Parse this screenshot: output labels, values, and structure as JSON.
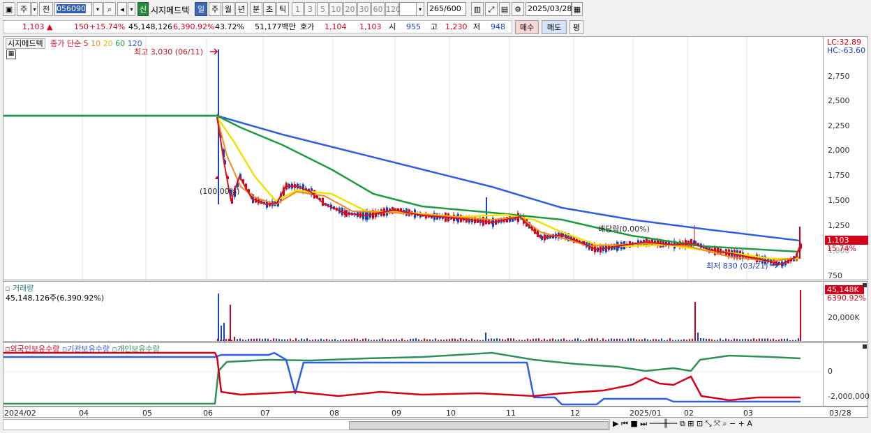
{
  "toolbar": {
    "type_select": "주",
    "prev_label": "전",
    "code_value": "056090",
    "credit_badge": "신",
    "stock_name": "시지메드텍",
    "period_buttons": [
      "일",
      "주",
      "월",
      "년",
      "분",
      "초",
      "틱"
    ],
    "interval_buttons": [
      "1",
      "3",
      "5",
      "10",
      "20",
      "30",
      "60",
      "120"
    ],
    "count_value": "265",
    "count_total": "/600",
    "date_value": "2025/03/28"
  },
  "quote": {
    "price": "1,103 ▲",
    "change": "150",
    "change_pct": "+15.74%",
    "volume": "45,148,126",
    "volume_pct": "6,390.92%",
    "turnover": "43.72%",
    "amount": "51,177백만",
    "ask_label": "호가",
    "ask1": "1,104",
    "ask2": "1,103",
    "open_label": "시",
    "open": "955",
    "high_label": "고",
    "high": "1,230",
    "low_label": "저",
    "low": "948",
    "buy_label": "매수",
    "sell_label": "매도",
    "avg_label": "평"
  },
  "price_panel": {
    "name": "시지메드텍",
    "ma_label": "종가 단순",
    "ma_periods": [
      "5",
      "10",
      "20",
      "60",
      "120"
    ],
    "high_note": "최고 3,030 (06/11)",
    "low_note": "최저 830 (03/21)",
    "pct_note": "(100.00%)",
    "dividend_note": "배당락(0.00%)",
    "lc": "LC:32.89",
    "hc": "HC:-63.60",
    "current_tag": "1,103",
    "current_pct": "15.74%",
    "y_ticks": [
      "2,750",
      "2,500",
      "2,250",
      "2,000",
      "1,750",
      "1,500",
      "1,250",
      "1,000",
      "750"
    ]
  },
  "volume_panel": {
    "title": "거래량",
    "value": "45,148,126주(6,390.92%)",
    "tag": "45,148K",
    "tag_pct": "6390.92%",
    "y_ticks": [
      "20,000K"
    ]
  },
  "holdings_panel": {
    "legend": [
      "외국인보유수량",
      "기관보유수량",
      "개인보유수량"
    ],
    "y_ticks": [
      "0",
      "-2,000,000"
    ]
  },
  "x_axis": {
    "labels": [
      "2024/02",
      "04",
      "05",
      "06",
      "07",
      "08",
      "09",
      "10",
      "11",
      "12",
      "2025/01",
      "02",
      "03"
    ],
    "right_label": "03/28"
  },
  "colors": {
    "ma5": "#d6121f",
    "ma10": "#ef8a1e",
    "ma20": "#f2e200",
    "ma60": "#1f9a3f",
    "ma120": "#2f5fe0",
    "up": "#d4001a",
    "down": "#1a3fbf",
    "foreign": "#d4001a",
    "inst": "#2f5fe0",
    "indiv": "#2f8f57"
  }
}
